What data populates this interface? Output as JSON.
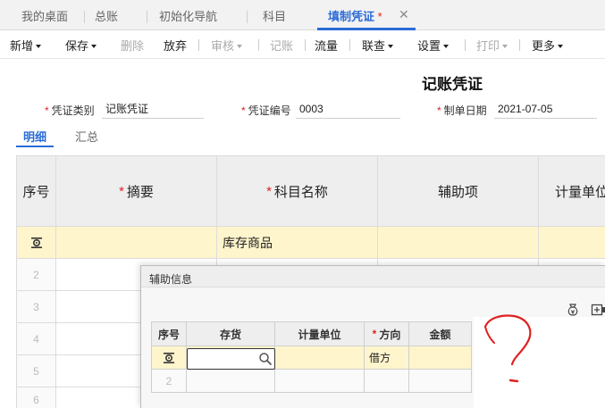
{
  "tabs": [
    {
      "label": "我的桌面",
      "active": false
    },
    {
      "label": "总账",
      "active": false
    },
    {
      "label": "初始化导航",
      "active": false
    },
    {
      "label": "科目",
      "active": false
    },
    {
      "label": "填制凭证",
      "active": true,
      "modified_mark": "*"
    }
  ],
  "tab_close_symbol": "✕",
  "toolbar": {
    "new": "新增",
    "save": "保存",
    "delete": "删除",
    "abandon": "放弃",
    "audit": "审核",
    "post": "记账",
    "flow": "流量",
    "link_query": "联查",
    "settings": "设置",
    "print": "打印",
    "more": "更多"
  },
  "voucher": {
    "title": "记账凭证",
    "type_label": "凭证类别",
    "type_value": "记账凭证",
    "number_label": "凭证编号",
    "number_value": "0003",
    "date_label": "制单日期",
    "date_value": "2021-07-05"
  },
  "detail_tabs": {
    "detail": "明细",
    "summary": "汇总"
  },
  "grid": {
    "headers": {
      "seq": "序号",
      "summary": "摘要",
      "account": "科目名称",
      "aux": "辅助项",
      "unit": "计量单位"
    },
    "first_row_account": "库存商品",
    "row_numbers": [
      "2",
      "3",
      "4",
      "5",
      "6"
    ]
  },
  "aux_dialog": {
    "title": "辅助信息",
    "headers": {
      "seq": "序号",
      "inventory": "存货",
      "unit": "计量单位",
      "direction": "方向",
      "amount": "金额"
    },
    "row1": {
      "direction": "借方"
    },
    "row2_number": "2"
  },
  "colors": {
    "accent": "#2b6cd6",
    "required": "#e02020",
    "row_highlight": "#fff5cc",
    "annotation": "#e02020"
  }
}
